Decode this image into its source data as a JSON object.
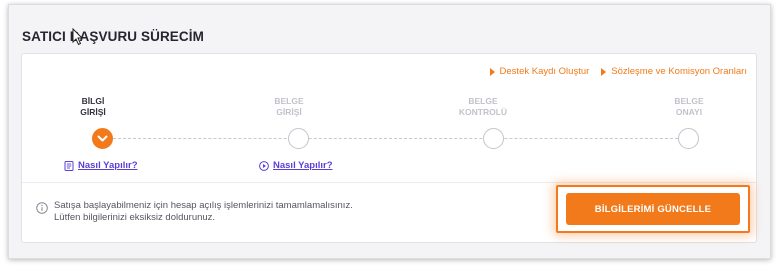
{
  "section": {
    "title": "SATICI BAŞVURU SÜRECİM"
  },
  "links": [
    {
      "label": "Destek Kaydı Oluştur"
    },
    {
      "label": "Sözleşme ve Komisyon Oranları"
    }
  ],
  "steps": [
    {
      "line1": "BİLGİ",
      "line2": "GİRİŞİ",
      "active": true
    },
    {
      "line1": "BELGE",
      "line2": "GİRİŞİ",
      "active": false
    },
    {
      "line1": "BELGE",
      "line2": "KONTROLÜ",
      "active": false
    },
    {
      "line1": "BELGE",
      "line2": "ONAYI",
      "active": false
    }
  ],
  "howto": [
    {
      "label": "Nasıl Yapılır?",
      "icon": "document-icon"
    },
    {
      "label": "Nasıl Yapılır?",
      "icon": "play-icon"
    }
  ],
  "info": {
    "line1": "Satışa başlayabilmeniz için hesap açılış işlemlerinizi tamamlamalısınız.",
    "line2": "Lütfen bilgilerinizi eksiksiz doldurunuz."
  },
  "cta": {
    "label": "BİLGİLERİMİ GÜNCELLE"
  },
  "colors": {
    "accent": "#f27a1a",
    "link": "#5b3fd6",
    "inactive": "#c2c2cc",
    "text": "#333340"
  }
}
